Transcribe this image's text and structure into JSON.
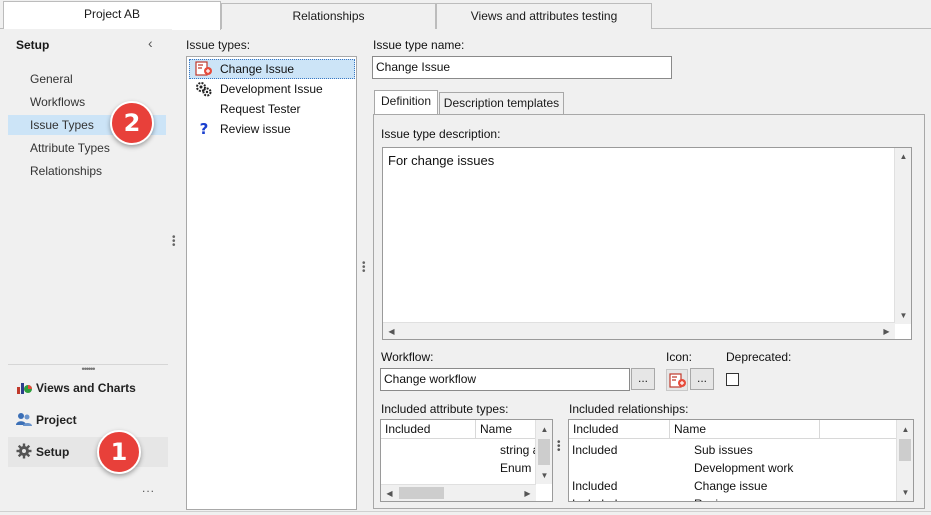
{
  "top_tabs": [
    {
      "label": "Project AB",
      "active": true
    },
    {
      "label": "Relationships",
      "active": false
    },
    {
      "label": "Views and attributes testing",
      "active": false
    }
  ],
  "sidebar": {
    "title": "Setup",
    "collapse_glyph": "‹",
    "items": [
      {
        "label": "General"
      },
      {
        "label": "Workflows"
      },
      {
        "label": "Issue Types",
        "selected": true
      },
      {
        "label": "Attribute Types"
      },
      {
        "label": "Relationships"
      }
    ],
    "grip": "••••••",
    "nav": [
      {
        "label": "Views and Charts",
        "icon": "chart-icon"
      },
      {
        "label": "Project",
        "icon": "users-icon"
      },
      {
        "label": "Setup",
        "icon": "gear-icon",
        "active": true
      }
    ],
    "more": "..."
  },
  "badges": {
    "one": "1",
    "two": "2"
  },
  "issue_types": {
    "label": "Issue types:",
    "items": [
      {
        "label": "Change Issue",
        "icon": "change-issue-icon",
        "selected": true
      },
      {
        "label": "Development Issue",
        "icon": "gears-icon"
      },
      {
        "label": "Request Tester",
        "icon": ""
      },
      {
        "label": "Review issue",
        "icon": "question-icon"
      }
    ]
  },
  "detail": {
    "name_label": "Issue type name:",
    "name_value": "Change Issue",
    "tabs": [
      {
        "label": "Definition",
        "active": true
      },
      {
        "label": "Description templates",
        "active": false
      }
    ],
    "desc_label": "Issue type description:",
    "desc_value": "For change issues",
    "workflow_label": "Workflow:",
    "workflow_value": "Change workflow",
    "browse_label": "...",
    "icon_label": "Icon:",
    "deprecated_label": "Deprecated:",
    "deprecated_checked": false,
    "attr_label": "Included attribute types:",
    "attr_columns": [
      "Included",
      "Name"
    ],
    "attr_rows": [
      {
        "included": "",
        "name": "string a"
      },
      {
        "included": "",
        "name": "Enum"
      },
      {
        "included": "",
        "name": "....."
      }
    ],
    "rel_label": "Included relationships:",
    "rel_columns": [
      "Included",
      "Name"
    ],
    "rel_rows": [
      {
        "included": "Included",
        "name": "Sub issues"
      },
      {
        "included": "",
        "name": "Development work"
      },
      {
        "included": "Included",
        "name": "Change issue"
      },
      {
        "included": "Included",
        "name": "Review"
      }
    ]
  }
}
